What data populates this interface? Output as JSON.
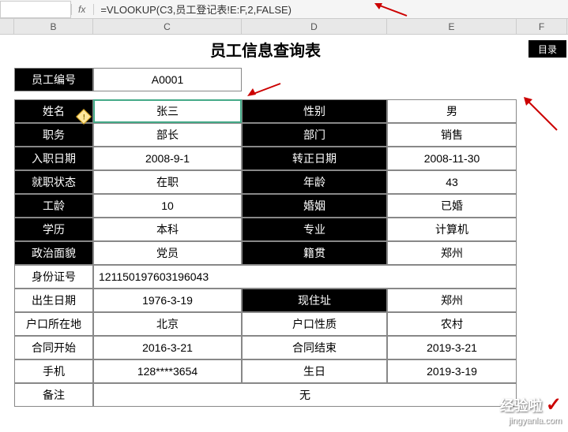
{
  "formula_bar": {
    "name_box": "",
    "fx_label": "fx",
    "formula": "=VLOOKUP(C3,员工登记表!E:F,2,FALSE)"
  },
  "columns": {
    "b": "B",
    "c": "C",
    "d": "D",
    "e": "E",
    "f": "F"
  },
  "title": "员工信息查询表",
  "menu_label": "目录",
  "search": {
    "label": "员工编号",
    "value": "A0001"
  },
  "rows": [
    {
      "l1": "姓名",
      "v1": "张三",
      "l2": "性别",
      "v2": "男"
    },
    {
      "l1": "职务",
      "v1": "部长",
      "l2": "部门",
      "v2": "销售"
    },
    {
      "l1": "入职日期",
      "v1": "2008-9-1",
      "l2": "转正日期",
      "v2": "2008-11-30"
    },
    {
      "l1": "就职状态",
      "v1": "在职",
      "l2": "年龄",
      "v2": "43"
    },
    {
      "l1": "工龄",
      "v1": "10",
      "l2": "婚姻",
      "v2": "已婚"
    },
    {
      "l1": "学历",
      "v1": "本科",
      "l2": "专业",
      "v2": "计算机"
    },
    {
      "l1": "政治面貌",
      "v1": "党员",
      "l2": "籍贯",
      "v2": "郑州"
    }
  ],
  "id_row": {
    "label": "身份证号",
    "value": "121150197603196043"
  },
  "rows2": [
    {
      "l1": "出生日期",
      "v1": "1976-3-19",
      "l2": "现住址",
      "v2": "郑州"
    },
    {
      "l1": "户口所在地",
      "v1": "北京",
      "l2": "户口性质",
      "v2": "农村"
    },
    {
      "l1": "合同开始",
      "v1": "2016-3-21",
      "l2": "合同结束",
      "v2": "2019-3-21"
    },
    {
      "l1": "手机",
      "v1": "128****3654",
      "l2": "生日",
      "v2": "2019-3-19"
    }
  ],
  "remark": {
    "label": "备注",
    "value": "无"
  },
  "watermark": {
    "main": "经验啦",
    "sub": "jingyanla.com"
  }
}
